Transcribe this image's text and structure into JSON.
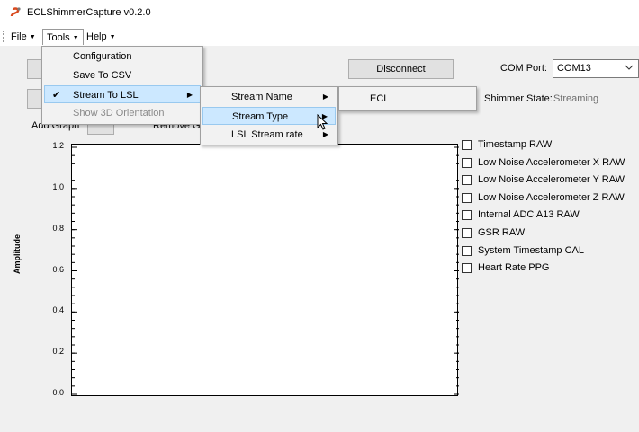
{
  "window": {
    "title": "ECLShimmerCapture v0.2.0"
  },
  "menubar": {
    "file": "File",
    "tools": "Tools",
    "help": "Help"
  },
  "tools_menu": {
    "items": [
      {
        "label": "Configuration"
      },
      {
        "label": "Save To CSV"
      },
      {
        "label": "Stream To LSL",
        "checked": true,
        "has_submenu": true
      },
      {
        "label": "Show 3D Orientation",
        "disabled": true
      }
    ]
  },
  "lsl_submenu": {
    "items": [
      {
        "label": "Stream Name"
      },
      {
        "label": "Stream Type"
      },
      {
        "label": "LSL Stream rate"
      }
    ]
  },
  "stream_type_submenu": {
    "items": [
      {
        "label": "ECL"
      }
    ]
  },
  "controls": {
    "disconnect_label": "Disconnect",
    "com_port_label": "COM Port:",
    "com_port_value": "COM13",
    "shimmer_state_label": "Shimmer State:",
    "shimmer_state_value": "Streaming",
    "add_graph_label": "Add Graph",
    "remove_graph_label": "Remove Gra"
  },
  "channels": [
    {
      "label": "Timestamp RAW",
      "checked": false
    },
    {
      "label": "Low Noise Accelerometer X RAW",
      "checked": false
    },
    {
      "label": "Low Noise Accelerometer Y RAW",
      "checked": false
    },
    {
      "label": "Low Noise Accelerometer Z RAW",
      "checked": false
    },
    {
      "label": "Internal ADC A13 RAW",
      "checked": false
    },
    {
      "label": "GSR RAW",
      "checked": false
    },
    {
      "label": "System Timestamp CAL",
      "checked": false
    },
    {
      "label": "Heart Rate PPG",
      "checked": false
    }
  ],
  "chart_data": {
    "type": "line",
    "title": "",
    "xlabel": "",
    "ylabel": "Amplitude",
    "ylim": [
      0.0,
      1.2
    ],
    "y_ticks": [
      "1.2",
      "1.0",
      "0.8",
      "0.6",
      "0.4",
      "0.2",
      "0.0"
    ],
    "series": []
  },
  "colors": {
    "menu_highlight": "#cce8ff",
    "menu_highlight_border": "#99c9ef",
    "window_bg": "#f0f0f0"
  }
}
